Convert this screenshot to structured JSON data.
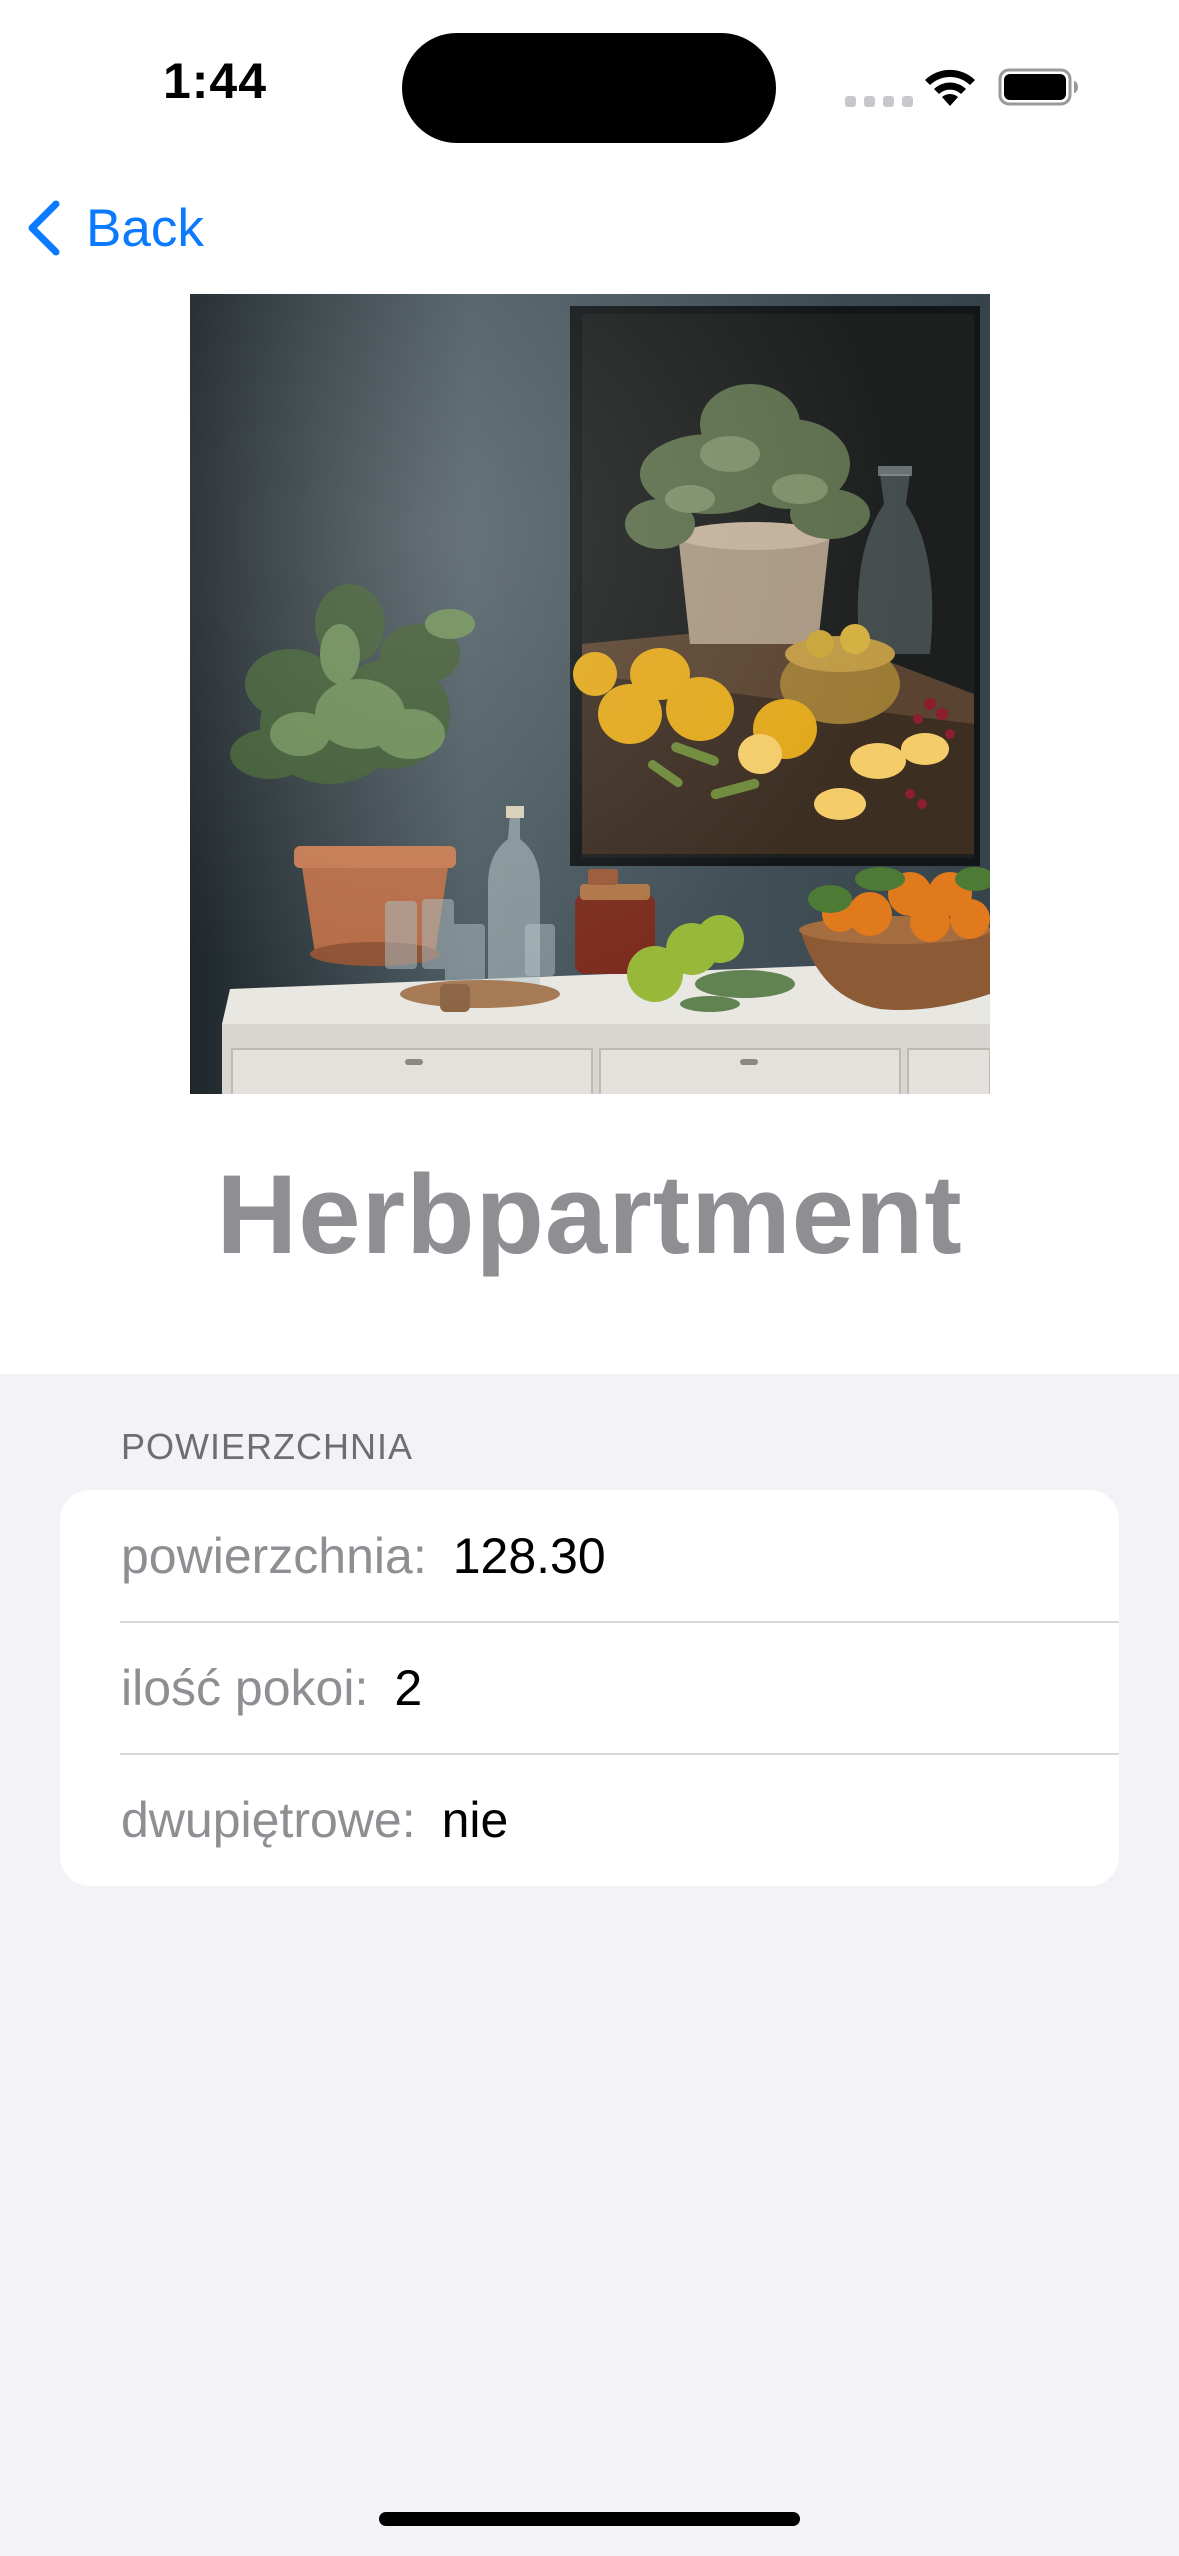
{
  "status_bar": {
    "time": "1:44",
    "icons": [
      "cellular-signal-icon",
      "wifi-icon",
      "battery-icon"
    ]
  },
  "nav": {
    "back_label": "Back"
  },
  "photo": {
    "subject": "kitchen-still-life-photo"
  },
  "listing": {
    "title": "Herbpartment"
  },
  "details_section": {
    "header": "POWIERZCHNIA",
    "rows": [
      {
        "label": "powierzchnia:",
        "value": "128.30"
      },
      {
        "label": "ilość pokoi:",
        "value": "2"
      },
      {
        "label": "dwupiętrowe:",
        "value": "nie"
      }
    ]
  },
  "colors": {
    "accent": "#0a7aff",
    "title": "#8e8e93",
    "background": "#f2f2f7",
    "card": "#ffffff"
  }
}
